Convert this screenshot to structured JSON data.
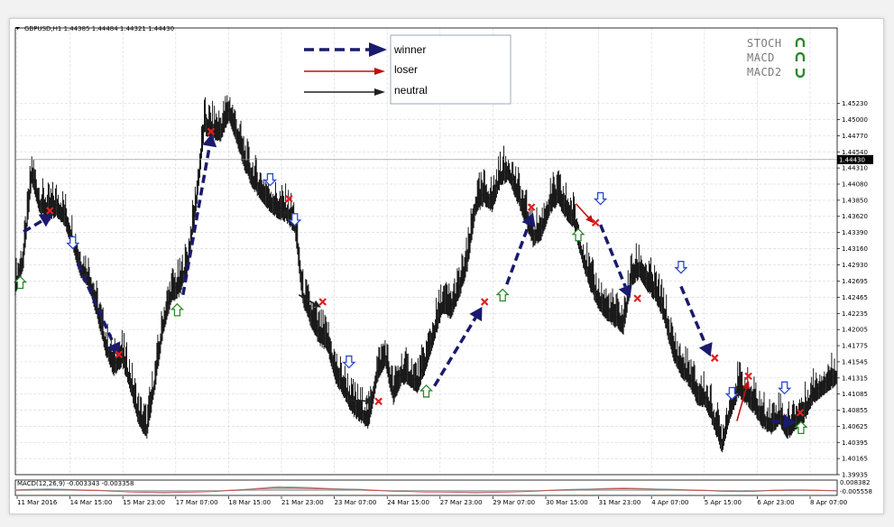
{
  "chart_data": {
    "type": "line",
    "title": "GBPUSD,H1  1.44385 1.44484 1.44321 1.44430",
    "symbol": "GBPUSD,H1",
    "ohlc": [
      "1.44385",
      "1.44484",
      "1.44321",
      "1.44430"
    ],
    "current_price": "1.44430",
    "ylim": [
      1.39935,
      1.4623
    ],
    "y_ticks": [
      "1.45230",
      "1.45000",
      "1.44770",
      "1.44540",
      "1.44310",
      "1.44080",
      "1.43850",
      "1.43620",
      "1.43390",
      "1.43160",
      "1.42930",
      "1.42695",
      "1.42465",
      "1.42235",
      "1.42005",
      "1.41775",
      "1.41545",
      "1.41315",
      "1.41085",
      "1.40855",
      "1.40625",
      "1.40395",
      "1.40165",
      "1.39935"
    ],
    "x_ticks": [
      "11 Mar 2016",
      "14 Mar 15:00",
      "15 Mar 23:00",
      "17 Mar 07:00",
      "18 Mar 15:00",
      "21 Mar 23:00",
      "23 Mar 07:00",
      "24 Mar 15:00",
      "27 Mar 23:00",
      "29 Mar 07:00",
      "30 Mar 15:00",
      "31 Mar 23:00",
      "4 Apr 07:00",
      "5 Apr 15:00",
      "6 Apr 23:00",
      "8 Apr 07:00"
    ],
    "x_range": [
      0,
      100
    ],
    "series": [
      {
        "x": [
          0,
          1,
          2,
          3,
          4,
          5,
          6,
          7,
          8,
          9,
          10,
          11,
          12,
          13,
          14,
          15,
          16,
          17,
          18,
          19,
          20,
          21,
          22,
          23,
          24,
          25,
          26,
          27,
          28,
          29,
          30,
          31,
          32,
          33,
          34,
          35,
          36,
          37,
          38,
          39,
          40,
          41,
          42,
          43,
          44,
          45,
          46,
          47,
          48,
          49,
          50,
          51,
          52,
          53,
          54,
          55,
          56,
          57,
          58,
          59,
          60,
          61,
          62,
          63,
          64,
          65,
          66,
          67,
          68,
          69,
          70,
          71,
          72,
          73,
          74,
          75,
          76,
          77,
          78,
          79,
          80,
          81,
          82,
          83,
          84,
          85,
          86,
          87,
          88,
          89,
          90,
          91,
          92,
          93,
          94,
          95,
          96,
          97,
          98,
          99,
          100
        ],
        "values": [
          1.4263,
          1.4305,
          1.4425,
          1.4381,
          1.4372,
          1.4378,
          1.4365,
          1.433,
          1.429,
          1.4275,
          1.423,
          1.418,
          1.415,
          1.4165,
          1.4128,
          1.408,
          1.406,
          1.413,
          1.421,
          1.4255,
          1.4265,
          1.43,
          1.4385,
          1.4495,
          1.4488,
          1.4486,
          1.4515,
          1.448,
          1.444,
          1.4415,
          1.44,
          1.4385,
          1.4375,
          1.437,
          1.4355,
          1.425,
          1.422,
          1.4195,
          1.4185,
          1.414,
          1.412,
          1.4095,
          1.4085,
          1.4075,
          1.414,
          1.4165,
          1.411,
          1.414,
          1.4135,
          1.4125,
          1.416,
          1.42,
          1.424,
          1.4232,
          1.426,
          1.43,
          1.438,
          1.4395,
          1.4385,
          1.442,
          1.443,
          1.44,
          1.437,
          1.4335,
          1.4345,
          1.438,
          1.4395,
          1.4375,
          1.436,
          1.431,
          1.427,
          1.4245,
          1.423,
          1.422,
          1.421,
          1.428,
          1.429,
          1.427,
          1.4255,
          1.4225,
          1.4175,
          1.415,
          1.4135,
          1.411,
          1.4105,
          1.4075,
          1.404,
          1.409,
          1.412,
          1.411,
          1.4095,
          1.4075,
          1.4068,
          1.408,
          1.406,
          1.4075,
          1.4085,
          1.411,
          1.412,
          1.413,
          1.4138
        ]
      }
    ],
    "legend": [
      {
        "label": "winner",
        "style": "dashed",
        "color": "#1a1a6e"
      },
      {
        "label": "loser",
        "style": "solid",
        "color": "#c01010"
      },
      {
        "label": "neutral",
        "style": "solid",
        "color": "#222222"
      }
    ],
    "indicators": [
      {
        "label": "STOCH",
        "color": "#2a8a2a",
        "state": "up"
      },
      {
        "label": "MACD",
        "color": "#2a8a2a",
        "state": "up"
      },
      {
        "label": "MACD2",
        "color": "#2a8a2a",
        "state": "down"
      }
    ],
    "signals": [
      {
        "x": 0.6,
        "y": 1.4267,
        "dir": "up"
      },
      {
        "x": 7.0,
        "y": 1.4325,
        "dir": "down"
      },
      {
        "x": 19.7,
        "y": 1.4228,
        "dir": "up"
      },
      {
        "x": 31.0,
        "y": 1.4415,
        "dir": "down"
      },
      {
        "x": 34.0,
        "y": 1.4358,
        "dir": "down"
      },
      {
        "x": 40.6,
        "y": 1.4155,
        "dir": "down"
      },
      {
        "x": 50.0,
        "y": 1.4112,
        "dir": "up"
      },
      {
        "x": 59.3,
        "y": 1.4249,
        "dir": "up"
      },
      {
        "x": 68.5,
        "y": 1.4335,
        "dir": "up"
      },
      {
        "x": 71.2,
        "y": 1.4388,
        "dir": "down"
      },
      {
        "x": 81.0,
        "y": 1.429,
        "dir": "down"
      },
      {
        "x": 87.2,
        "y": 1.411,
        "dir": "down"
      },
      {
        "x": 93.6,
        "y": 1.4118,
        "dir": "down"
      },
      {
        "x": 95.6,
        "y": 1.406,
        "dir": "up"
      }
    ],
    "exits": [
      {
        "x": 4.2,
        "y": 1.437
      },
      {
        "x": 12.6,
        "y": 1.4165
      },
      {
        "x": 23.8,
        "y": 1.4483
      },
      {
        "x": 33.3,
        "y": 1.4387
      },
      {
        "x": 37.4,
        "y": 1.424
      },
      {
        "x": 44.2,
        "y": 1.4098
      },
      {
        "x": 57.1,
        "y": 1.424
      },
      {
        "x": 62.8,
        "y": 1.4375
      },
      {
        "x": 70.6,
        "y": 1.4353
      },
      {
        "x": 75.7,
        "y": 1.4245
      },
      {
        "x": 85.1,
        "y": 1.416
      },
      {
        "x": 89.2,
        "y": 1.4134
      },
      {
        "x": 95.5,
        "y": 1.4082
      }
    ],
    "trades": [
      {
        "x1": 1.0,
        "y1": 1.434,
        "x2": 4.6,
        "y2": 1.4365,
        "result": "winner"
      },
      {
        "x1": 7.6,
        "y1": 1.4295,
        "x2": 12.6,
        "y2": 1.4163,
        "result": "winner"
      },
      {
        "x1": 20.4,
        "y1": 1.425,
        "x2": 23.9,
        "y2": 1.448,
        "result": "winner"
      },
      {
        "x1": 31.0,
        "y1": 1.437,
        "x2": 33.6,
        "y2": 1.4365,
        "result": "neutral"
      },
      {
        "x1": 34.5,
        "y1": 1.425,
        "x2": 37.2,
        "y2": 1.4232,
        "result": "neutral"
      },
      {
        "x1": 40.3,
        "y1": 1.41,
        "x2": 43.6,
        "y2": 1.4098,
        "result": "neutral"
      },
      {
        "x1": 51.0,
        "y1": 1.412,
        "x2": 56.8,
        "y2": 1.4233,
        "result": "winner"
      },
      {
        "x1": 59.8,
        "y1": 1.4265,
        "x2": 63.0,
        "y2": 1.4367,
        "result": "winner"
      },
      {
        "x1": 68.2,
        "y1": 1.438,
        "x2": 70.4,
        "y2": 1.4352,
        "result": "loser"
      },
      {
        "x1": 71.2,
        "y1": 1.435,
        "x2": 74.8,
        "y2": 1.4245,
        "result": "winner"
      },
      {
        "x1": 81.0,
        "y1": 1.4262,
        "x2": 84.6,
        "y2": 1.4162,
        "result": "winner"
      },
      {
        "x1": 87.8,
        "y1": 1.407,
        "x2": 89.2,
        "y2": 1.4128,
        "result": "loser"
      },
      {
        "x1": 92.0,
        "y1": 1.407,
        "x2": 95.0,
        "y2": 1.4068,
        "result": "winner"
      }
    ],
    "sub_chart": {
      "label": "MACD(12,26,9) -0.003343 -0.003358",
      "tick_top": "0.008382",
      "tick_bottom": "-0.005558",
      "values": [
        0.2,
        0.3,
        0.4,
        0.3,
        0.2,
        0.1,
        -0.1,
        -0.3,
        -0.4,
        -0.5,
        -0.4,
        -0.3,
        -0.2,
        0.1,
        0.3,
        0.6,
        0.9,
        0.8,
        0.7,
        0.5,
        0.4,
        0.3,
        0.1,
        -0.1,
        -0.2,
        -0.3,
        -0.3,
        -0.4,
        -0.5,
        -0.4,
        -0.3,
        -0.2,
        0.0,
        0.2,
        0.3,
        0.4,
        0.5,
        0.6,
        0.5,
        0.4,
        0.3,
        0.2,
        0.1,
        -0.1,
        -0.2,
        -0.1,
        0.1,
        0.2,
        0.2,
        0.1,
        0.0
      ]
    },
    "grid": true,
    "colors": {
      "price": "#1a1a1a",
      "grid": "#dcdcdc",
      "winner": "#1a1a6e",
      "loser": "#c01010",
      "neutral": "#222222",
      "exit": "#e02020",
      "signal_up": "#2a8a2a",
      "signal_down": "#2a4acf",
      "price_tag_bg": "#000000"
    }
  }
}
